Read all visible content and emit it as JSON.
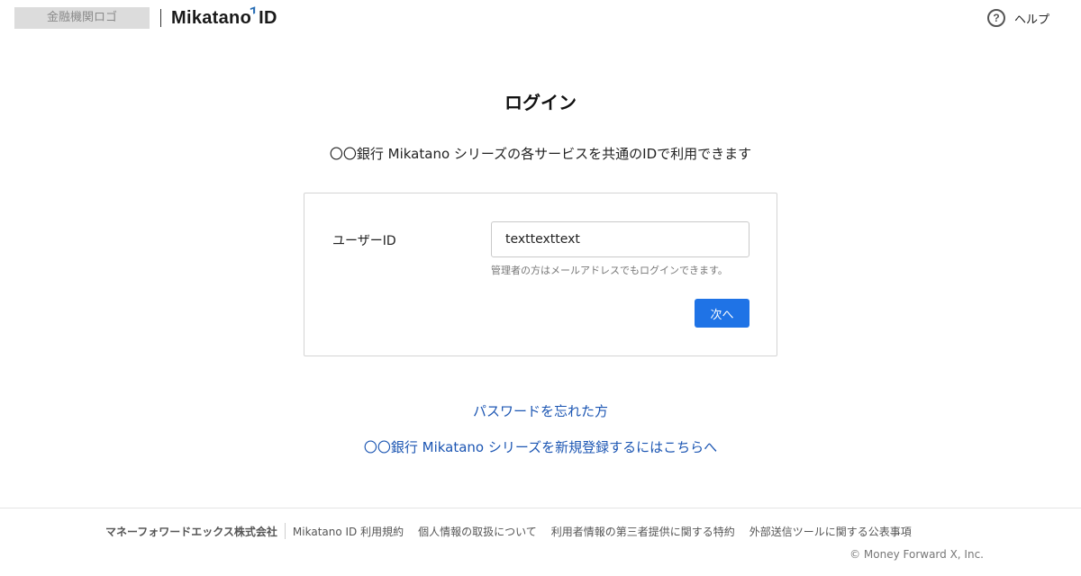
{
  "header": {
    "bank_logo": "金融機関ロゴ",
    "brand": "Mikatano",
    "brand_suffix": "ID",
    "help_icon": "question-circle-icon",
    "help_label": "ヘルプ",
    "accent_color": "#2b6fb5"
  },
  "main": {
    "title": "ログイン",
    "subtitle": "〇〇銀行 Mikatano シリーズの各サービスを共通のIDで利用できます",
    "form": {
      "user_id_label": "ユーザーID",
      "user_id_value": "texttexttext",
      "hint": "管理者の方はメールアドレスでもログインできます。",
      "next_label": "次へ",
      "button_color": "#1f73e6"
    },
    "links": {
      "forgot_password": "パスワードを忘れた方",
      "register": "〇〇銀行 Mikatano シリーズを新規登録するにはこちらへ",
      "link_color": "#1c56b3"
    }
  },
  "footer": {
    "company": "マネーフォワードエックス株式会社",
    "links": [
      "Mikatano ID 利用規約",
      "個人情報の取扱について",
      "利用者情報の第三者提供に関する特約",
      "外部送信ツールに関する公表事項"
    ],
    "copyright": "© Money Forward X, Inc."
  }
}
